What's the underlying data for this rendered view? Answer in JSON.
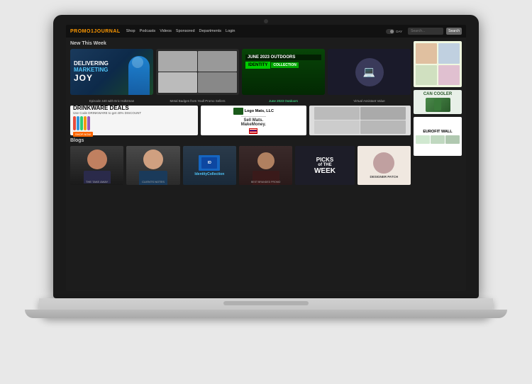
{
  "laptop": {
    "nav": {
      "logo_text": "PROMO",
      "logo_accent": "1",
      "logo_suffix": "JOURNAL",
      "links": [
        "Shop",
        "Podcasts",
        "Videos",
        "Sponsored",
        "Departments",
        "Login"
      ],
      "search_placeholder": "Search...",
      "search_btn": "Search"
    },
    "screen": {
      "section_new_this_week": "New This Week",
      "section_blogs": "Blogs",
      "cards": [
        {
          "id": "card-1",
          "title_line1": "DELIVERING",
          "title_line2": "MARKETING",
          "title_line3": "JOY",
          "caption": "Episode 440 with Eric Holtzman"
        },
        {
          "id": "card-2",
          "caption": "Metal Badges from Youll Promo Sellers"
        },
        {
          "id": "card-3",
          "label_top": "JUNE 2023 OUTDOORS",
          "label_identity": "IDENTITY",
          "label_collection": "COLLECTION",
          "caption": "June 2023 Outdoors"
        },
        {
          "id": "card-4",
          "caption": "Virtual Assistant Value"
        }
      ],
      "ads": [
        {
          "id": "drinkware",
          "title": "DRINKWARE DEALS",
          "subtitle": "Use Code DRINKWARE to get 40% DISCOUNT",
          "button": "SHOP NOW"
        },
        {
          "id": "logo-mats",
          "line1": "Logo Mats, LLC",
          "line2": "Sell Mats.",
          "line3": "MakeMoney."
        },
        {
          "id": "can-cooler",
          "title": "CAN COOLER"
        }
      ],
      "blogs": [
        {
          "id": "blog-takeaway",
          "label": "THE TAKE AWAY"
        },
        {
          "id": "blog-notes",
          "label": "CLIENTS NOTES"
        },
        {
          "id": "blog-identity",
          "label": "IdentityCollection"
        },
        {
          "id": "blog-branding",
          "label": "BEST BRANDED PROMO"
        },
        {
          "id": "blog-picks",
          "label_picks": "PICKS",
          "label_of": "of THE",
          "label_week": "WEEK"
        },
        {
          "id": "blog-designer",
          "label": "DESIGNER PATCH"
        },
        {
          "id": "blog-eurofit",
          "label": "EUROFIT WALL"
        }
      ]
    }
  }
}
